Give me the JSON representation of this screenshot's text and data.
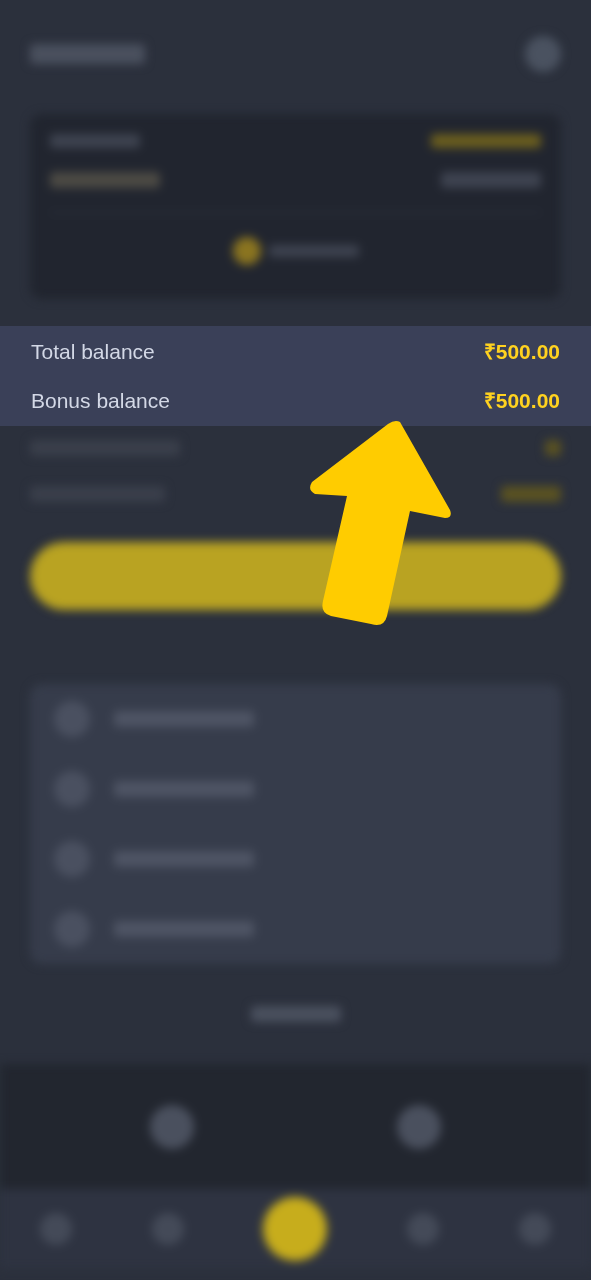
{
  "balances": [
    {
      "label": "Total balance",
      "amount": "₹500.00"
    },
    {
      "label": "Bonus balance",
      "amount": "₹500.00"
    }
  ]
}
